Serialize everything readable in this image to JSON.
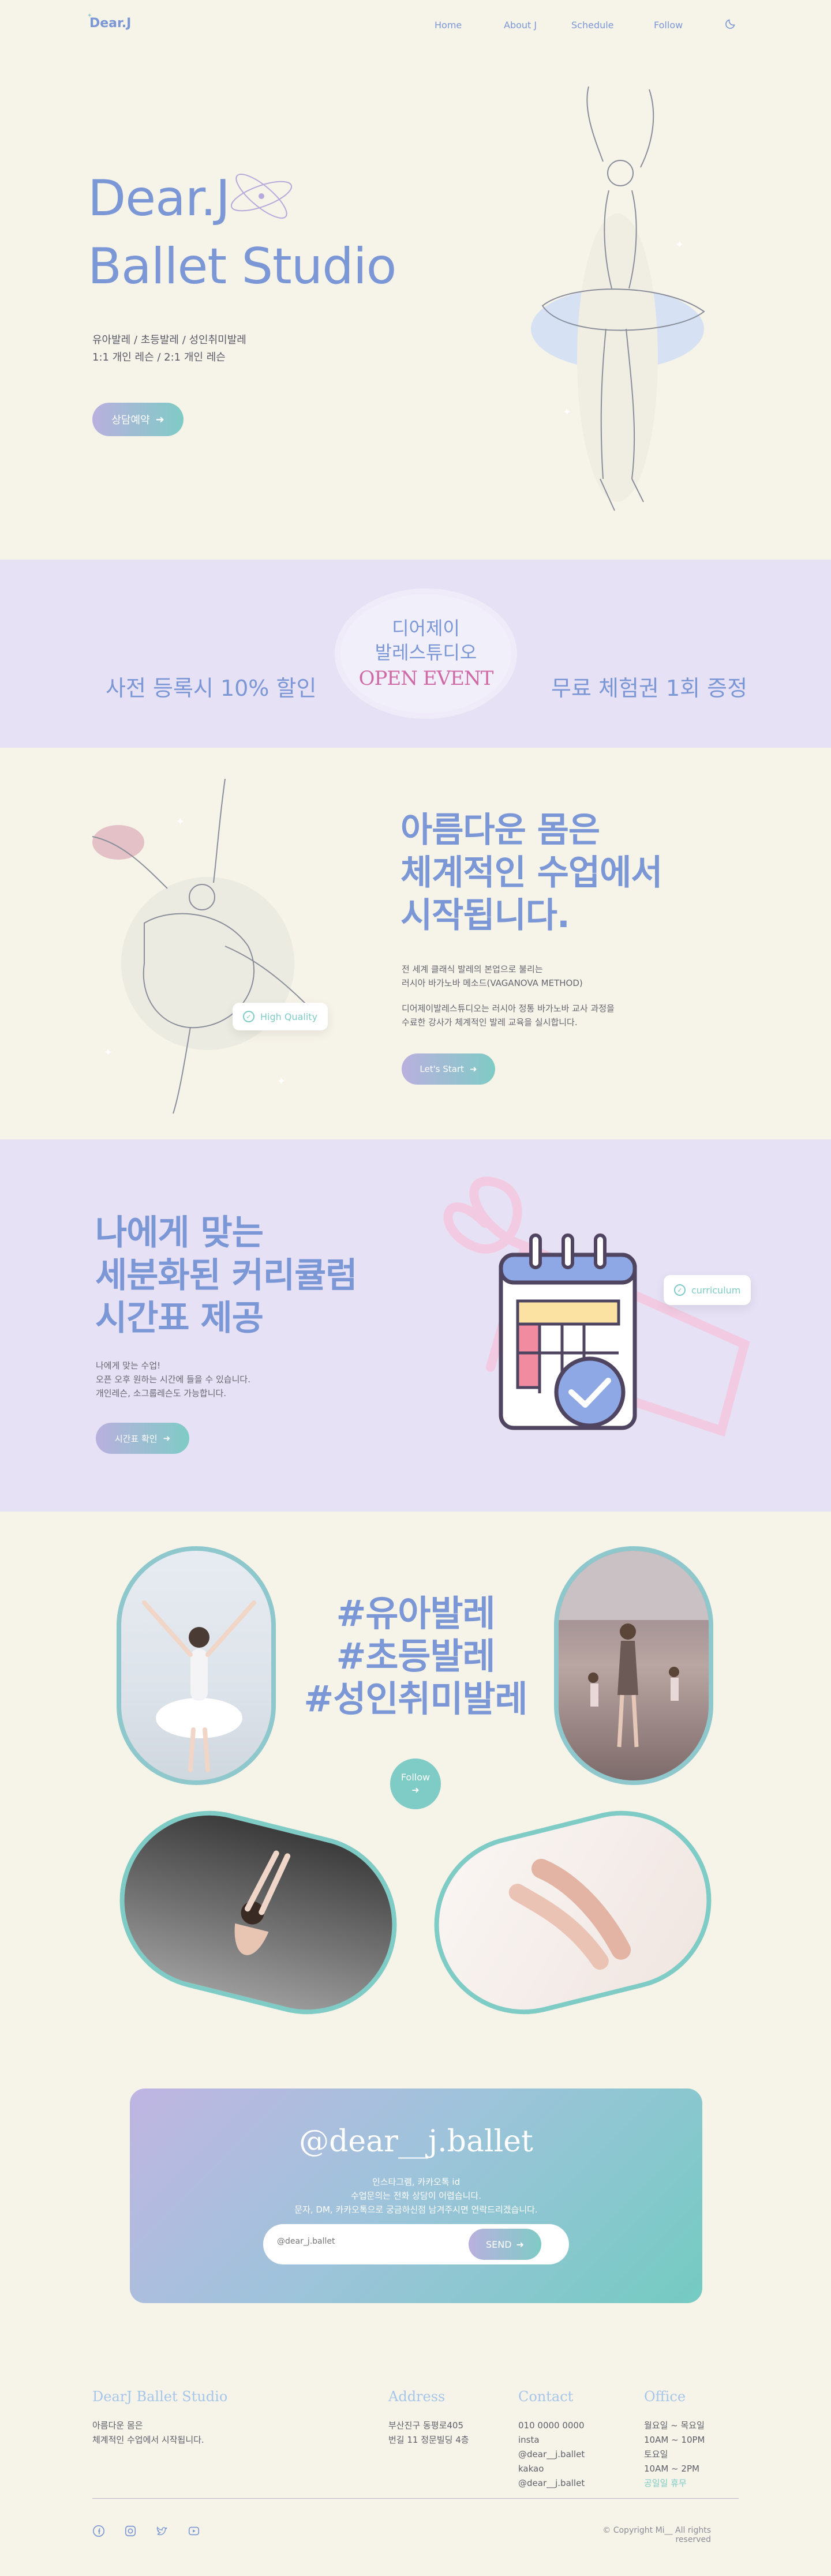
{
  "nav": {
    "logo": "Dear.J",
    "items": [
      "Home",
      "About J",
      "Schedule",
      "Follow"
    ]
  },
  "hero": {
    "title_line1": "Dear.J",
    "title_line2": "Ballet Studio",
    "sub_line1": "유아발레 / 초등발레 / 성인취미발레",
    "sub_line2": "1:1 개인 레슨 / 2:1 개인 레슨",
    "cta": "상담예약"
  },
  "event": {
    "left": "사전 등록시 10% 할인",
    "oval_line1": "디어제이",
    "oval_line2": "발레스튜디오",
    "oval_line3": "OPEN EVENT",
    "right": "무료 체험권 1회 증정"
  },
  "intro": {
    "title_line1": "아름다운 몸은",
    "title_line2": "체계적인 수업에서",
    "title_line3": "시작됩니다.",
    "p1_line1": "전 세계 클래식 발레의 본업으로 불리는",
    "p1_line2": "러시아 바가노바 메소드(VAGANOVA METHOD)",
    "p2_line1": "디어제이발레스튜디오는 러시아 정통 바가노바 교사 과정을",
    "p2_line2": "수료한 강사가 체계적인 발레 교육을 실시합니다.",
    "badge": "High Quality",
    "cta": "Let's Start"
  },
  "curriculum": {
    "title_line1": "나에게 맞는",
    "title_line2": "세분화된 커리큘럼",
    "title_line3": "시간표 제공",
    "p_line1": "나에게 맞는 수업!",
    "p_line2": "오픈 오후 원하는 시간에 들을 수 있습니다.",
    "p_line3": "개인레슨, 소그룹레슨도 가능합니다.",
    "cta": "시간표 확인",
    "badge": "curriculum"
  },
  "tags": {
    "line1": "#유아발레",
    "line2": "#초등발레",
    "line3": "#성인취미발레",
    "follow": "Follow"
  },
  "insta": {
    "handle": "@dear__j.ballet",
    "sub_line1": "인스타그램, 카카오톡 id",
    "sub_line2": "수업문의는 전화 상담이 어렵습니다.",
    "sub_line3": "문자, DM, 카카오톡으로 궁금하신점 남겨주시면 연락드리겠습니다.",
    "placeholder": "@dear_j.ballet",
    "send": "SEND"
  },
  "footer": {
    "brand": "DearJ Ballet Studio",
    "brand_line1": "아름다운 몸은",
    "brand_line2": "체계적인 수업에서 시작됩니다.",
    "address_head": "Address",
    "address_line1": "부산진구 동평로405",
    "address_line2": "번길 11 정문빌딩 4층",
    "contact_head": "Contact",
    "contact_lines": [
      "010 0000 0000",
      "insta",
      "@dear__j.ballet",
      "kakao",
      "@dear__j.ballet"
    ],
    "office_head": "Office",
    "office_lines": [
      "월요일 ~ 목요일",
      "10AM ~ 10PM",
      "토요일",
      "10AM ~ 2PM"
    ],
    "office_closed": "공일일 휴무",
    "copyright": "© Copyright Mi__ All rights reserved"
  },
  "colors": {
    "bg": "#f6f3e8",
    "lavender_band": "#e6e1f5",
    "accent_blue": "#7b97d6",
    "accent_teal": "#7fcbc5",
    "accent_pink": "#cf6aa6"
  }
}
